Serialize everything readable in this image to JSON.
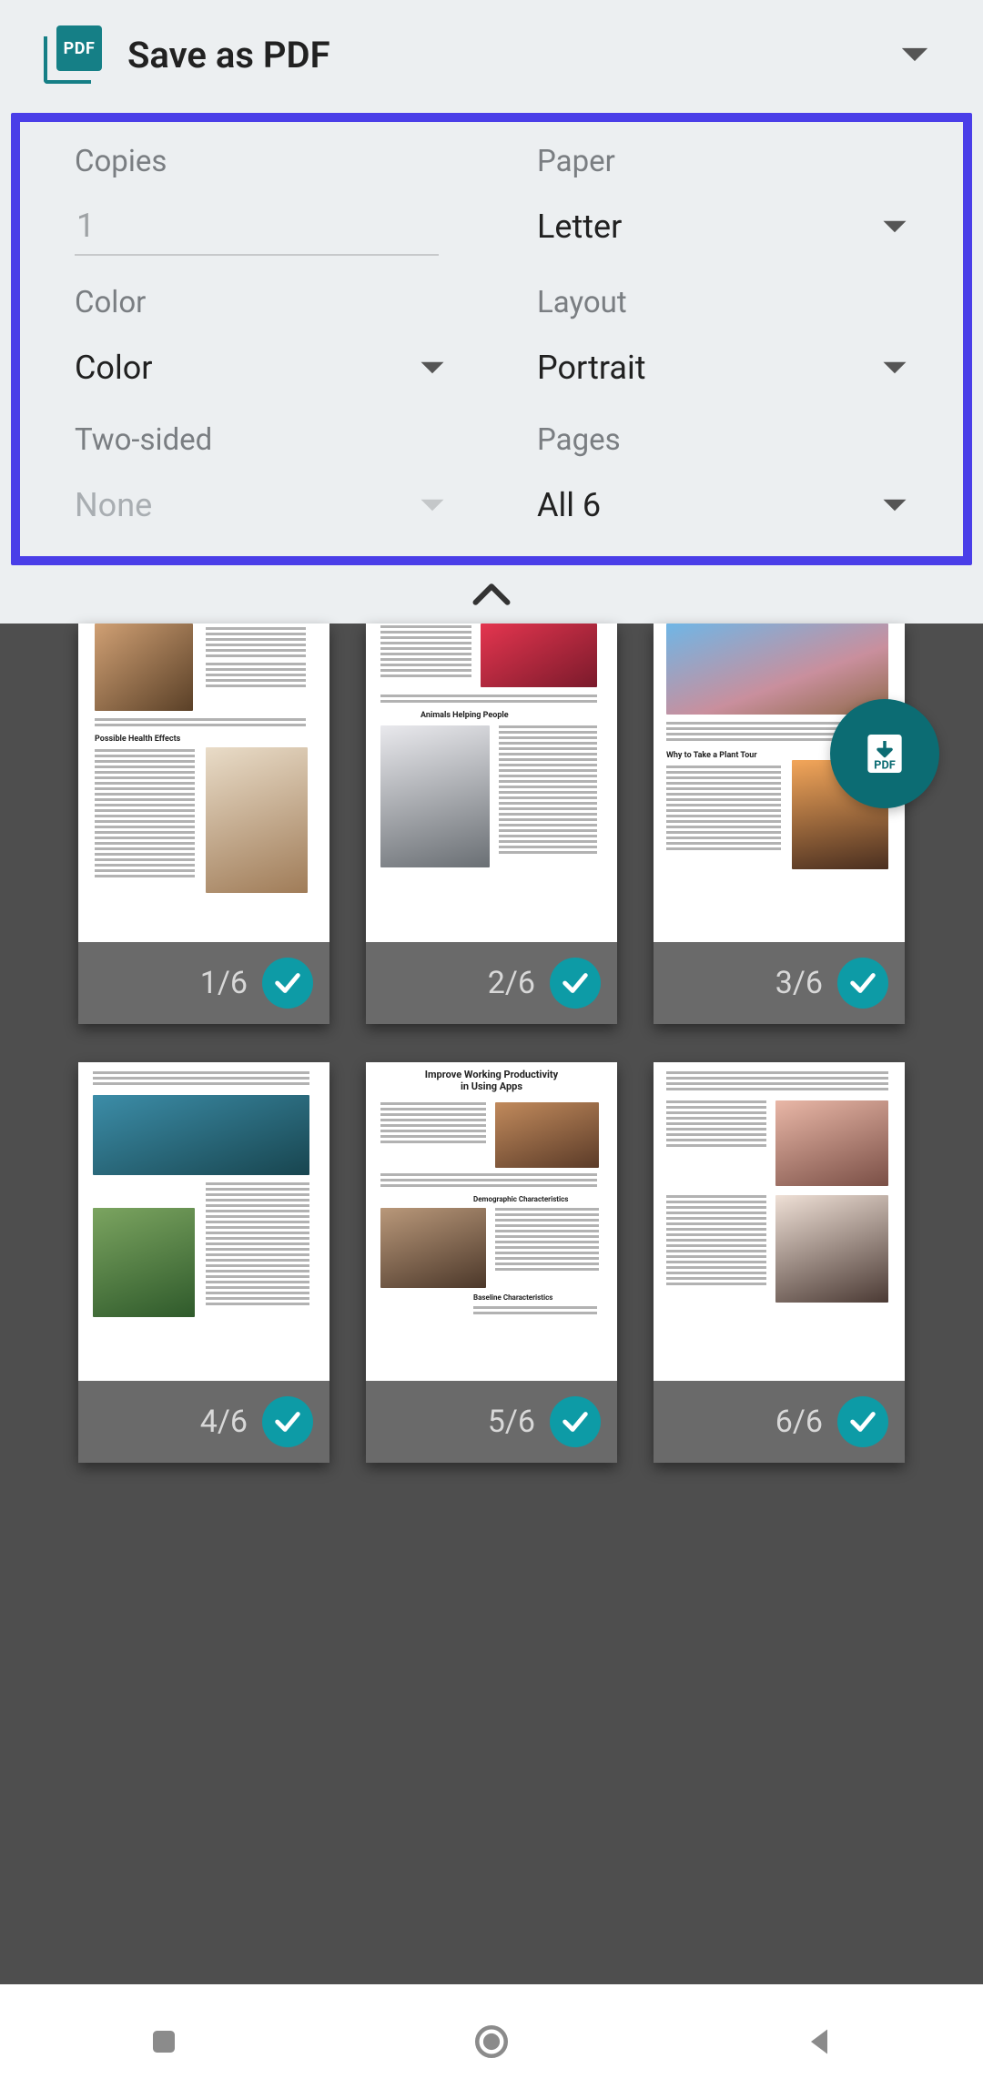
{
  "header": {
    "printer_label": "Save as PDF",
    "pdf_badge_text": "PDF"
  },
  "options": {
    "copies": {
      "label": "Copies",
      "value": "1"
    },
    "paper": {
      "label": "Paper",
      "value": "Letter"
    },
    "color": {
      "label": "Color",
      "value": "Color"
    },
    "layout": {
      "label": "Layout",
      "value": "Portrait"
    },
    "two_sided": {
      "label": "Two-sided",
      "value": "None",
      "disabled": true
    },
    "pages": {
      "label": "Pages",
      "value": "All 6"
    }
  },
  "fab": {
    "download_label": "PDF"
  },
  "pages": [
    {
      "index": "1/6",
      "selected": true
    },
    {
      "index": "2/6",
      "selected": true
    },
    {
      "index": "3/6",
      "selected": true
    },
    {
      "index": "4/6",
      "selected": true
    },
    {
      "index": "5/6",
      "selected": true
    },
    {
      "index": "6/6",
      "selected": true
    }
  ],
  "page_content": {
    "p1_heading": "Possible Health Effects",
    "p2_heading": "Animals Helping People",
    "p3_heading": "Why to Take a Plant Tour",
    "p5_title_l1": "Improve Working Productivity",
    "p5_title_l2": "in Using Apps",
    "p5_h1": "Demographic Characteristics",
    "p5_h2": "Baseline Characteristics"
  },
  "colors": {
    "accent_outline": "#4a3ee8",
    "teal": "#0d9ba6",
    "teal_dark": "#0c6c73"
  }
}
